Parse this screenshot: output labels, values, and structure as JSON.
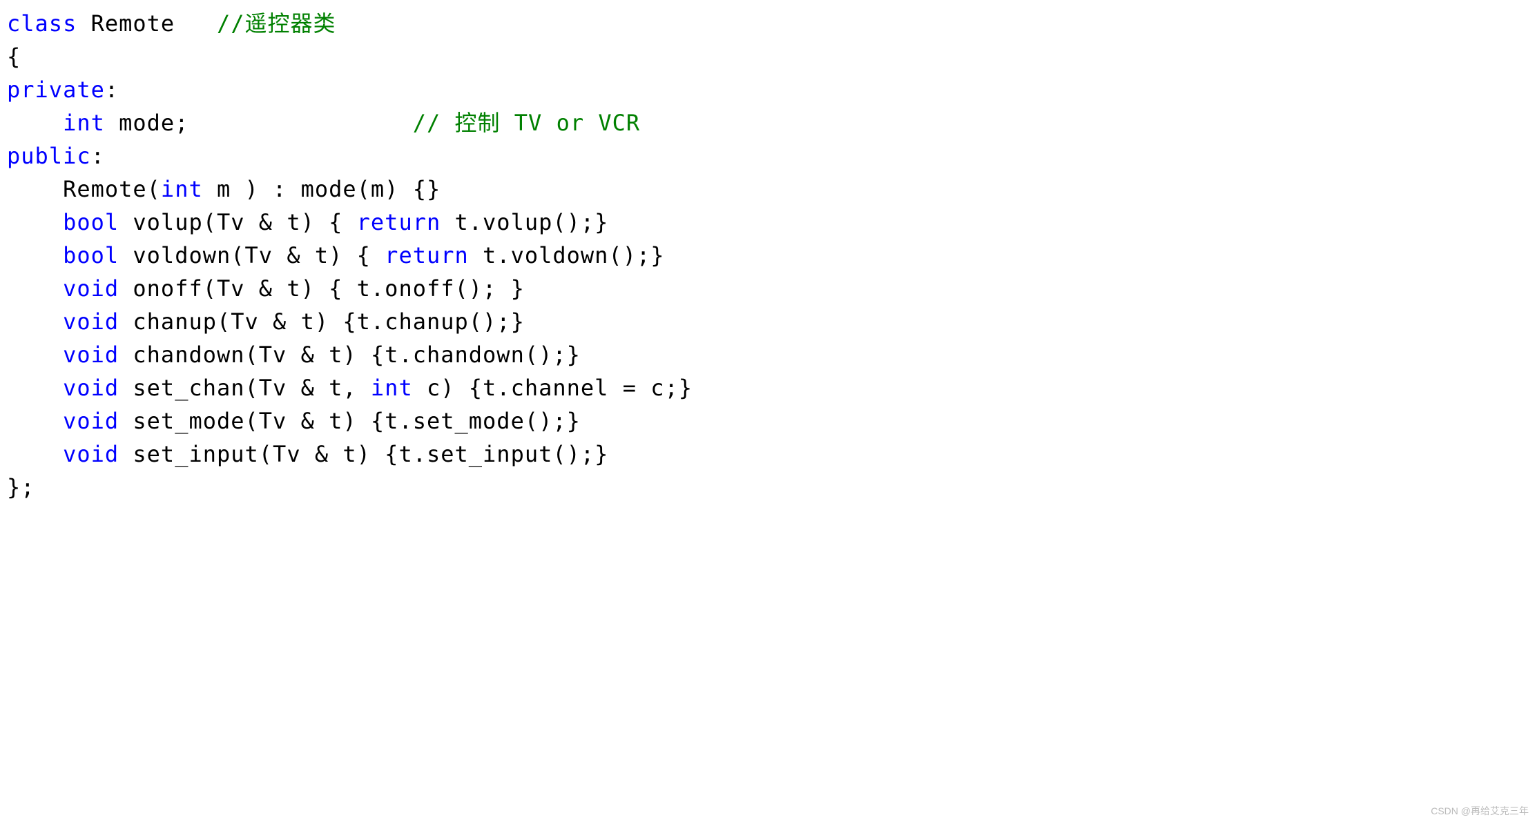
{
  "code": {
    "l1_kw": "class",
    "l1_name": " Remote   ",
    "l1_cmt": "//遥控器类",
    "l2": "{",
    "l3_kw": "private",
    "l3_colon": ":",
    "l4_pre": "    ",
    "l4_kw": "int",
    "l4_rest": " mode;                ",
    "l4_cmt": "// 控制 TV or VCR",
    "l5_kw": "public",
    "l5_colon": ":",
    "l6_pre": "    Remote(",
    "l6_kw": "int",
    "l6_rest": " m ) : mode(m) {}",
    "l7_pre": "    ",
    "l7_kw1": "bool",
    "l7_mid": " volup(Tv & t) { ",
    "l7_kw2": "return",
    "l7_rest": " t.volup();}",
    "l8_pre": "    ",
    "l8_kw1": "bool",
    "l8_mid": " voldown(Tv & t) { ",
    "l8_kw2": "return",
    "l8_rest": " t.voldown();}",
    "l9_pre": "    ",
    "l9_kw": "void",
    "l9_rest": " onoff(Tv & t) { t.onoff(); }",
    "l10_pre": "    ",
    "l10_kw": "void",
    "l10_rest": " chanup(Tv & t) {t.chanup();}",
    "l11_pre": "    ",
    "l11_kw": "void",
    "l11_rest": " chandown(Tv & t) {t.chandown();}",
    "l12_pre": "    ",
    "l12_kw1": "void",
    "l12_mid": " set_chan(Tv & t, ",
    "l12_kw2": "int",
    "l12_rest": " c) {t.channel = c;}",
    "l13_pre": "    ",
    "l13_kw": "void",
    "l13_rest": " set_mode(Tv & t) {t.set_mode();}",
    "l14_pre": "    ",
    "l14_kw": "void",
    "l14_rest": " set_input(Tv & t) {t.set_input();}",
    "l15": "};"
  },
  "watermark": "CSDN @再给艾克三年"
}
